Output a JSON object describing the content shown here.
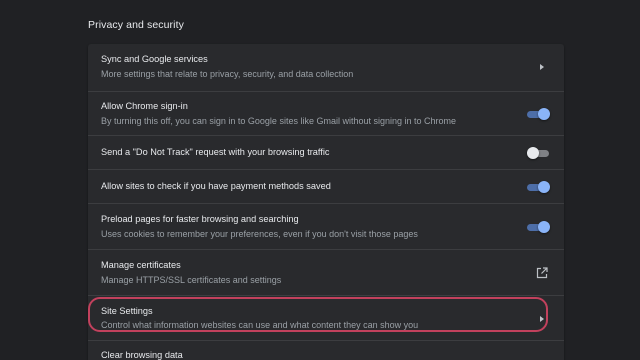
{
  "section": {
    "title": "Privacy and security"
  },
  "rows": [
    {
      "title": "Sync and Google services",
      "subtitle": "More settings that relate to privacy, security, and data collection",
      "control": "chevron-right-icon"
    },
    {
      "title": "Allow Chrome sign-in",
      "subtitle": "By turning this off, you can sign in to Google sites like Gmail without signing in to Chrome",
      "control": "toggle",
      "state": "on"
    },
    {
      "title": "Send a \"Do Not Track\" request with your browsing traffic",
      "control": "toggle",
      "state": "off"
    },
    {
      "title": "Allow sites to check if you have payment methods saved",
      "control": "toggle",
      "state": "on"
    },
    {
      "title": "Preload pages for faster browsing and searching",
      "subtitle": "Uses cookies to remember your preferences, even if you don't visit those pages",
      "control": "toggle",
      "state": "on"
    },
    {
      "title": "Manage certificates",
      "subtitle": "Manage HTTPS/SSL certificates and settings",
      "control": "open-in-new-icon"
    },
    {
      "title": "Site Settings",
      "subtitle": "Control what information websites can use and what content they can show you",
      "control": "chevron-right-icon"
    },
    {
      "title": "Clear browsing data"
    }
  ],
  "colors": {
    "background": "#202124",
    "card": "#292a2d",
    "text_primary": "#e8eaed",
    "text_secondary": "#9aa0a6",
    "toggle_on": "#8ab4f8",
    "highlight": "#c2415d"
  }
}
